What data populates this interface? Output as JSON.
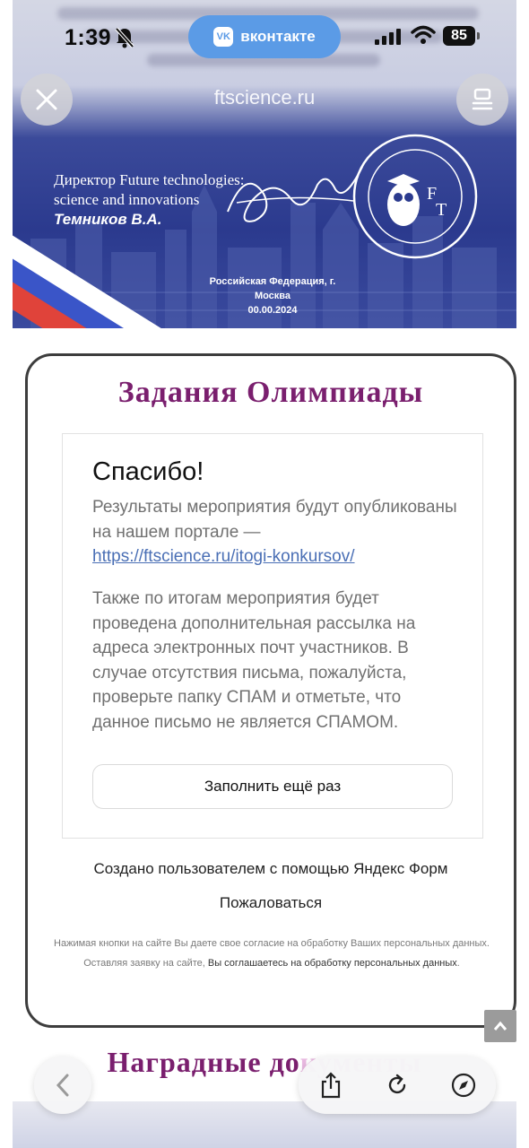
{
  "status_bar": {
    "time": "1:39",
    "app_name": "вконтакте",
    "app_logo": "VK",
    "battery": "85"
  },
  "banner": {
    "url": "ftscience.ru",
    "director_line1": "Директор  Future technologies:",
    "director_line2": "science and innovations",
    "director_name": "Темников В.А.",
    "location": "Российская Федерация, г. Москва",
    "date": "00.00.2024",
    "seal_text": "Future technologies: science and innovations",
    "seal_monogram_f": "F",
    "seal_monogram_t": "T"
  },
  "card": {
    "title": "Задания Олимпиады",
    "thanks": "Спасибо!",
    "para1": "Результаты мероприятия будут опубликованы на нашем портале —",
    "link": "https://ftscience.ru/itogi-konkursov/",
    "para2": "Также по итогам мероприятия будет проведена дополнительная рассылка на адреса электронных почт участников. В случае отсутствия письма, пожалуйста, проверьте папку СПАМ и отметьте, что данное письмо не является СПАМОМ.",
    "again_button": "Заполнить ещё раз",
    "created_by": "Создано пользователем с помощью Яндекс Форм",
    "complain": "Пожаловаться",
    "consent_plain": "Нажимая кнопки на сайте Вы даете свое согласие на обработку Ваших персональных данных. Оставляя заявку на сайте, ",
    "consent_strong": "Вы соглашаетесь на обработку персональных данных",
    "consent_end": "."
  },
  "next_section": {
    "title_visible": "Наградные до",
    "title_faded": "кументы"
  },
  "colors": {
    "title_purple": "#7a1f6e",
    "vk_blue": "#5b9be6",
    "banner_blue": "#2b3a8e",
    "link_blue": "#4a6fb5"
  },
  "icons": [
    "bell-off-icon",
    "signal-icon",
    "wifi-icon",
    "close-icon",
    "reader-icon",
    "chevron-up-icon",
    "chevron-left-icon",
    "share-icon",
    "reload-icon",
    "compass-icon"
  ]
}
